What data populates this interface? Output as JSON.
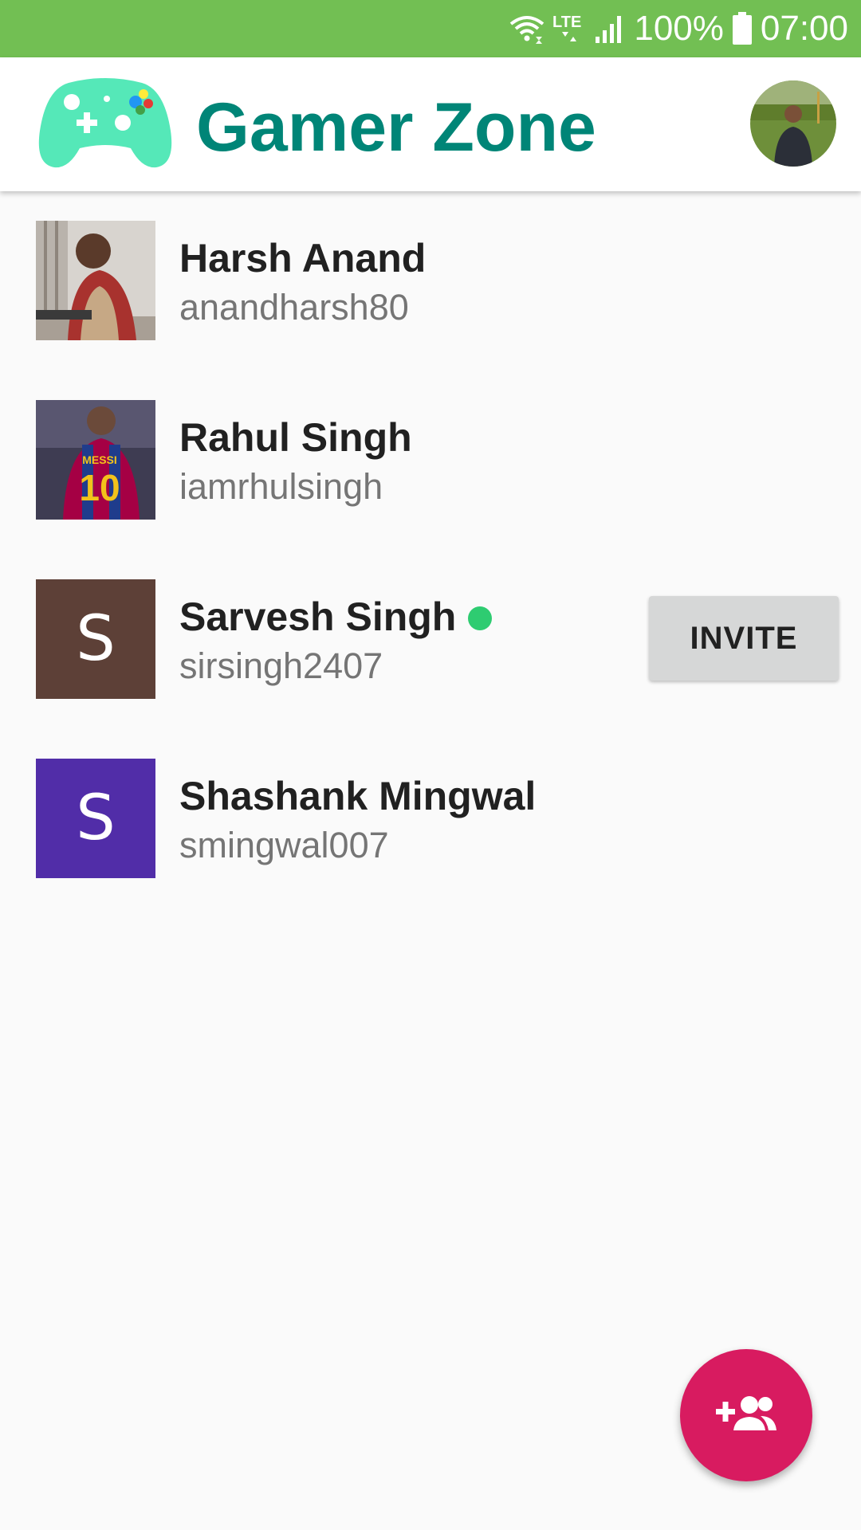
{
  "status_bar": {
    "network_label": "LTE",
    "battery_text": "100%",
    "time": "07:00",
    "icons": [
      "wifi-icon",
      "lte-icon",
      "signal-icon",
      "battery-icon"
    ]
  },
  "app_bar": {
    "title": "Gamer Zone",
    "logo_icon": "gamepad-icon",
    "title_color": "#008577"
  },
  "users": [
    {
      "name": "Harsh Anand",
      "username": "anandharsh80",
      "avatar_type": "photo",
      "online": false,
      "show_invite": false
    },
    {
      "name": "Rahul Singh",
      "username": "iamrhulsingh",
      "avatar_type": "photo",
      "online": false,
      "show_invite": false
    },
    {
      "name": "Sarvesh Singh",
      "username": "sirsingh2407",
      "avatar_type": "letter",
      "avatar_letter": "S",
      "avatar_color": "#5d4037",
      "online": true,
      "show_invite": true
    },
    {
      "name": "Shashank Mingwal",
      "username": "smingwal007",
      "avatar_type": "letter",
      "avatar_letter": "S",
      "avatar_color": "#512da8",
      "online": false,
      "show_invite": false
    }
  ],
  "invite_label": "INVITE",
  "fab": {
    "icon": "add-group-icon",
    "color": "#d81b60"
  },
  "colors": {
    "status_bar": "#72bf53",
    "online": "#2ecc71",
    "background": "#fafafa"
  }
}
